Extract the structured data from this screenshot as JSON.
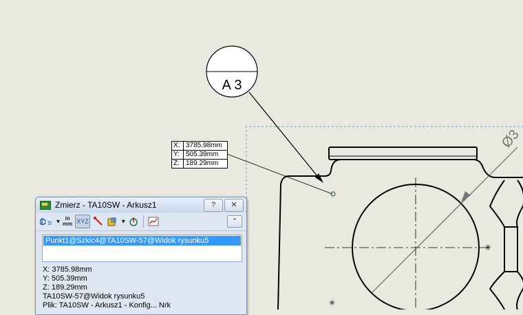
{
  "balloon": {
    "label": "A 3"
  },
  "diameter_label": "Ø3",
  "coord_readout": {
    "rows": [
      {
        "k": "X:",
        "v": "3785.98mm"
      },
      {
        "k": "Y:",
        "v": "505.39mm"
      },
      {
        "k": "Z:",
        "v": "189.29mm"
      }
    ]
  },
  "dialog": {
    "title": "Zmierz - TA10SW - Arkusz1",
    "help_label": "?",
    "close_label": "✕",
    "toolbar": {
      "units_top": "in",
      "units_bottom": "mm",
      "xyz_label": "XYZ",
      "collapse_label": "⌃"
    },
    "selection": "Punkt1@Szkic4@TA10SW-57@Widok rysunku5",
    "results": [
      "X: 3785.98mm",
      "Y: 505.39mm",
      "Z: 189.29mm",
      "TA10SW-57@Widok rysunku5",
      "Plik: TA10SW - Arkusz1 - Konfig... Nrk"
    ]
  },
  "colors": {
    "background": "#e9e9df",
    "selection": "#3399ff",
    "dialog": "#dde6f1"
  }
}
